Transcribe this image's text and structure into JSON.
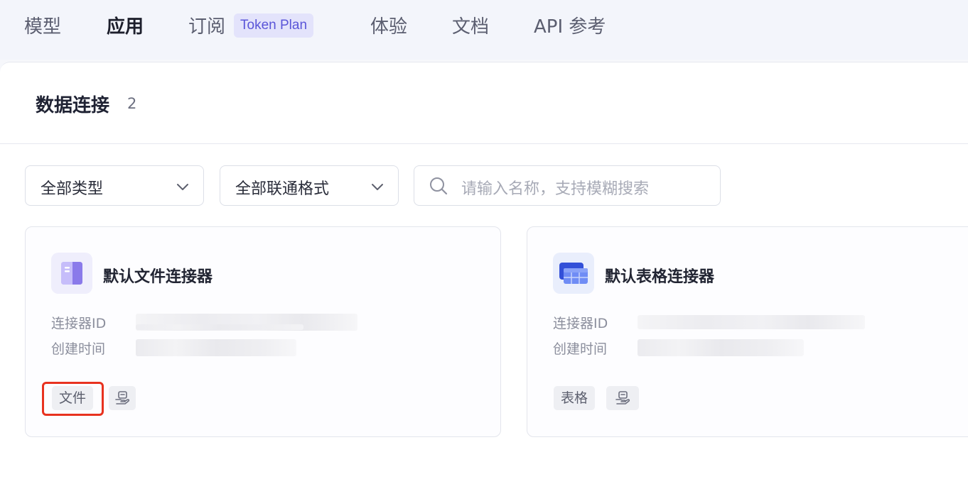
{
  "topnav": {
    "items": [
      {
        "label": "模型"
      },
      {
        "label": "应用",
        "active": true
      },
      {
        "label": "订阅"
      },
      {
        "label": "体验"
      },
      {
        "label": "文档"
      },
      {
        "label": "API 参考"
      }
    ],
    "badge": "Token Plan"
  },
  "page": {
    "title": "数据连接",
    "count": "2"
  },
  "filters": {
    "type_select": "全部类型",
    "format_select": "全部联通格式",
    "search_placeholder": "请输入名称，支持模糊搜索"
  },
  "cards": [
    {
      "name": "默认文件连接器",
      "id_label": "连接器ID",
      "created_label": "创建时间",
      "tag": "文件",
      "icon": "book-icon",
      "highlighted": true
    },
    {
      "name": "默认表格连接器",
      "id_label": "连接器ID",
      "created_label": "创建时间",
      "tag": "表格",
      "icon": "table-icon",
      "highlighted": false
    }
  ],
  "colors": {
    "accent": "#5a55d8",
    "badge_bg": "#e3e3fb",
    "highlight_border": "#e8321f",
    "page_bg": "#f6f7fb"
  }
}
